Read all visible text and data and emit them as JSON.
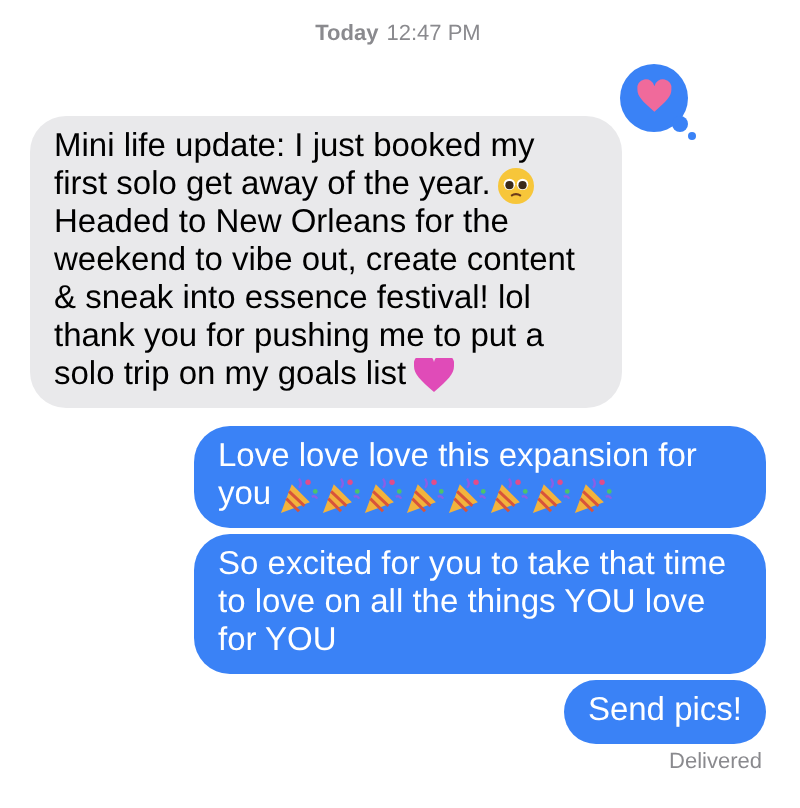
{
  "timestamp": {
    "day": "Today",
    "time": "12:47 PM"
  },
  "messages": [
    {
      "sent": false,
      "heart_reaction": true,
      "parts": [
        {
          "kind": "text",
          "text": "Mini life update: I just booked my"
        },
        {
          "kind": "line",
          "text": "first solo get away of the year."
        },
        {
          "kind": "pleading-face"
        },
        {
          "kind": "text",
          "text": "Headed to New Orleans for the weekend to vibe out, create content & sneak into essence festival! lol thank you for pushing me to put a"
        },
        {
          "kind": "line",
          "text": "solo trip on my goals list"
        },
        {
          "kind": "heart"
        }
      ]
    },
    {
      "sent": true,
      "heart_reaction": false,
      "parts": [
        {
          "kind": "text",
          "text": "Love love love this expansion for"
        },
        {
          "kind": "line",
          "text": "you"
        },
        {
          "kind": "party-popper"
        },
        {
          "kind": "party-popper"
        },
        {
          "kind": "party-popper"
        },
        {
          "kind": "party-popper"
        },
        {
          "kind": "party-popper"
        },
        {
          "kind": "party-popper"
        },
        {
          "kind": "party-popper"
        },
        {
          "kind": "party-popper"
        }
      ]
    },
    {
      "sent": true,
      "heart_reaction": false,
      "parts": [
        {
          "kind": "text",
          "text": "So excited for you to take that time to love on all the things YOU love for YOU"
        }
      ]
    },
    {
      "sent": true,
      "heart_reaction": false,
      "parts": [
        {
          "kind": "text",
          "text": "Send pics!"
        }
      ]
    }
  ],
  "status": "Delivered"
}
